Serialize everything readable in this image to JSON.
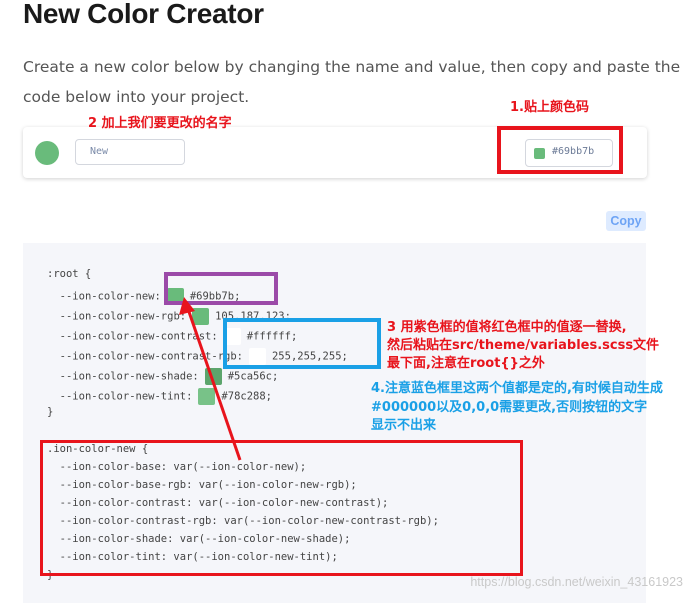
{
  "page": {
    "title": "New Color Creator",
    "description_line1": "Create a new color below by changing the name and value, then copy and paste the",
    "description_line2": "code below into your project."
  },
  "creator": {
    "name_placeholder": "New",
    "value": "#69bb7b",
    "swatch_color": "#69bb7b"
  },
  "copy_label": "Copy",
  "code": {
    "root_open": ":root {",
    "root_lines": [
      {
        "prop": "--ion-color-new:",
        "value": "#69bb7b;",
        "swatch": "#69bb7b"
      },
      {
        "prop": "--ion-color-new-rgb:",
        "value": "105,187,123;",
        "swatch": "#69bb7b"
      },
      {
        "prop": "--ion-color-new-contrast:",
        "value": "#ffffff;",
        "swatch": "#ffffff"
      },
      {
        "prop": "--ion-color-new-contrast-rgb:",
        "value": "255,255,255;",
        "swatch": "#ffffff"
      },
      {
        "prop": "--ion-color-new-shade:",
        "value": "#5ca56c;",
        "swatch": "#5ca56c"
      },
      {
        "prop": "--ion-color-new-tint:",
        "value": "#78c288;",
        "swatch": "#78c288"
      }
    ],
    "close": "}",
    "class_open": ".ion-color-new {",
    "class_lines": [
      "--ion-color-base: var(--ion-color-new);",
      "--ion-color-base-rgb: var(--ion-color-new-rgb);",
      "--ion-color-contrast: var(--ion-color-new-contrast);",
      "--ion-color-contrast-rgb: var(--ion-color-new-contrast-rgb);",
      "--ion-color-shade: var(--ion-color-new-shade);",
      "--ion-color-tint: var(--ion-color-new-tint);"
    ]
  },
  "annotations": {
    "a1": "1.贴上颜色码",
    "a2": "2 加上我们要更改的名字",
    "a3_l1": "3 用紫色框的值将红色框中的值逐一替换,",
    "a3_l2": "然后粘贴在src/theme/variables.scss文件",
    "a3_l3": "最下面,注意在root{}之外",
    "a4_l1": "4.注意蓝色框里这两个值都是定的,有时候自动生成",
    "a4_l2": "#000000以及0,0,0需要更改,否则按钮的文字",
    "a4_l3": "显示不出来",
    "colors": {
      "red": "#e8141c",
      "purple": "#9b4aa8",
      "blue": "#1aa0e6"
    }
  },
  "watermark": "https://blog.csdn.net/weixin_43161923"
}
